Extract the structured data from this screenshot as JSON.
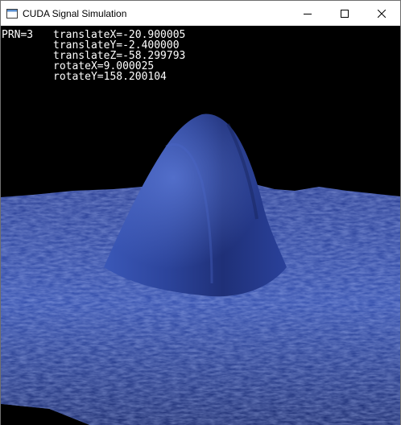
{
  "window": {
    "title": "CUDA Signal Simulation",
    "icon": "app-window-icon",
    "controls": [
      "minimize-icon",
      "maximize-icon",
      "close-icon"
    ]
  },
  "overlay": {
    "prn": "PRN=3",
    "translate_x": "translateX=-20.900005",
    "translate_y": "translateY=-2.400000",
    "translate_z": "translateZ=-58.299793",
    "rotate_x": "rotateX=9.000025",
    "rotate_y": "rotateY=158.200104"
  },
  "colors": {
    "background": "#000000",
    "surface_dark": "#1a2a66",
    "surface_mid": "#2d46a0",
    "surface_light": "#5b78d0"
  }
}
